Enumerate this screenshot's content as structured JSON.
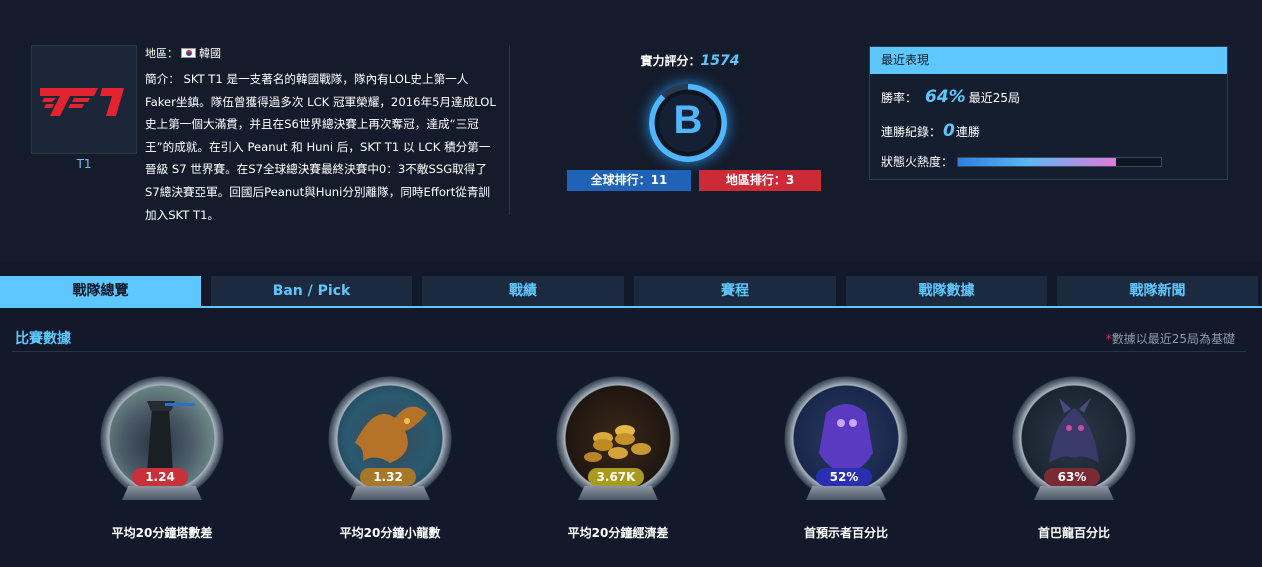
{
  "team": {
    "name": "T1",
    "region_label": "地區：",
    "region": "韓國",
    "description": "簡介： SKT T1 是一支著名的韓國戰隊，隊內有LOL史上第一人Faker坐鎮。隊伍曾獲得過多次 LCK 冠軍榮耀，2016年5月達成LOL史上第一個大滿貫，并且在S6世界總決賽上再次奪冠，達成“三冠王”的成就。在引入 Peanut 和 Huni 后，SKT T1 以 LCK 積分第一晉級 S7 世界賽。在S7全球總決賽最終決賽中0：3不敵SSG取得了S7總決賽亞軍。回國后Peanut與Huni分別離隊，同時Effort從青訓加入SKT T1。"
  },
  "rating": {
    "label": "實力評分：",
    "value": "1574",
    "grade": "B",
    "global_rank": "全球排行：11",
    "region_rank": "地區排行：3"
  },
  "recent": {
    "title": "最近表現",
    "winrate_label": "勝率：",
    "winrate_value": "64%",
    "winrate_suffix": "最近25局",
    "streak_label": "連勝紀錄：",
    "streak_value": "0",
    "streak_suffix": "連勝",
    "heat_label": "狀態火熱度：",
    "heat_level": 0.78
  },
  "tabs": [
    "戰隊總覽",
    "Ban / Pick",
    "戰績",
    "賽程",
    "戰隊數據",
    "戰隊新聞"
  ],
  "stats_section": {
    "title": "比賽數據",
    "note_star": "*",
    "note": "數據以最近25局為基礎"
  },
  "stats": [
    {
      "value": "1.24",
      "label": "平均20分鐘塔數差",
      "color": "#c8303a",
      "art": "tower-icon"
    },
    {
      "value": "1.32",
      "label": "平均20分鐘小龍數",
      "color": "#a8782a",
      "art": "dragon-icon"
    },
    {
      "value": "3.67K",
      "label": "平均20分鐘經濟差",
      "color": "#a89a1c",
      "art": "gold-coins-icon"
    },
    {
      "value": "52%",
      "label": "首預示者百分比",
      "color": "#2a2eb0",
      "art": "herald-icon"
    },
    {
      "value": "63%",
      "label": "首巴龍百分比",
      "color": "#7a2a35",
      "art": "baron-icon"
    }
  ],
  "colors": {
    "accent": "#5ec7ff",
    "background": "#12192a",
    "global_rank_bg": "#2062b6",
    "region_rank_bg": "#cc2a37"
  }
}
